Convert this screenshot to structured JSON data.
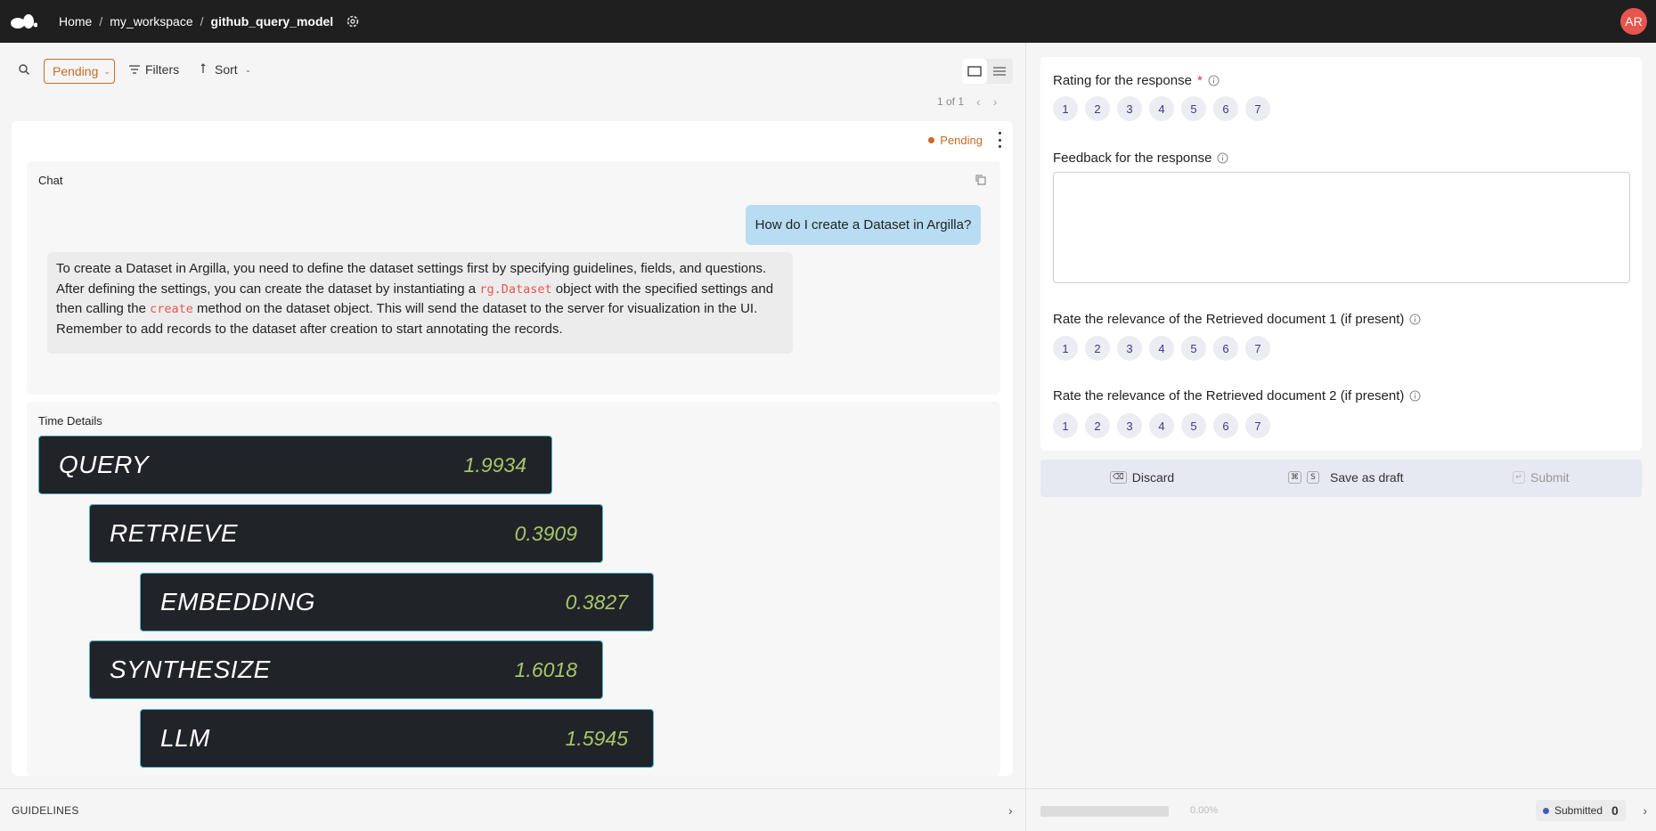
{
  "topbar": {
    "breadcrumbs": [
      "Home",
      "my_workspace",
      "github_query_model"
    ],
    "avatar_initials": "AR"
  },
  "toolbar": {
    "status_filter": "Pending",
    "filters_label": "Filters",
    "sort_label": "Sort",
    "pager": "1 of 1"
  },
  "record": {
    "status": "Pending",
    "chat": {
      "title": "Chat",
      "user_message": "How do I create a Dataset in Argilla?",
      "bot_message": {
        "part1": "To create a Dataset in Argilla, you need to define the dataset settings first by specifying guidelines, fields, and questions. After defining the settings, you can create the dataset by instantiating a ",
        "code1": "rg.Dataset",
        "part2": " object with the specified settings and then calling the ",
        "code2": "create",
        "part3": " method on the dataset object. This will send the dataset to the server for visualization in the UI. Remember to add records to the dataset after creation to start annotating the records."
      }
    },
    "time_details": {
      "title": "Time Details",
      "steps": [
        {
          "name": "QUERY",
          "value": "1.9934",
          "level": 0
        },
        {
          "name": "RETRIEVE",
          "value": "0.3909",
          "level": 1
        },
        {
          "name": "EMBEDDING",
          "value": "0.3827",
          "level": 2
        },
        {
          "name": "SYNTHESIZE",
          "value": "1.6018",
          "level": 1
        },
        {
          "name": "LLM",
          "value": "1.5945",
          "level": 2
        }
      ]
    }
  },
  "guidelines_label": "GUIDELINES",
  "form": {
    "q1": {
      "label": "Rating for the response",
      "required_mark": "*"
    },
    "q2": {
      "label": "Feedback for the response"
    },
    "q3": {
      "label": "Rate the relevance of the Retrieved document 1 (if present)"
    },
    "q4": {
      "label": "Rate the relevance of the Retrieved document 2 (if present)"
    },
    "rating_options": [
      "1",
      "2",
      "3",
      "4",
      "5",
      "6",
      "7"
    ]
  },
  "actions": {
    "discard": "Discard",
    "save_draft": "Save as draft",
    "save_key1": "⌘",
    "save_key2": "S",
    "submit": "Submit"
  },
  "footer": {
    "progress": 0,
    "progress_text": "0.00%",
    "submitted_label": "Submitted",
    "submitted_count": "0"
  },
  "colors": {
    "accent_pending": "#c86a25",
    "time_value": "#a7c66b",
    "time_border": "#4fb3c9",
    "user_bubble": "#b8dcf2"
  }
}
